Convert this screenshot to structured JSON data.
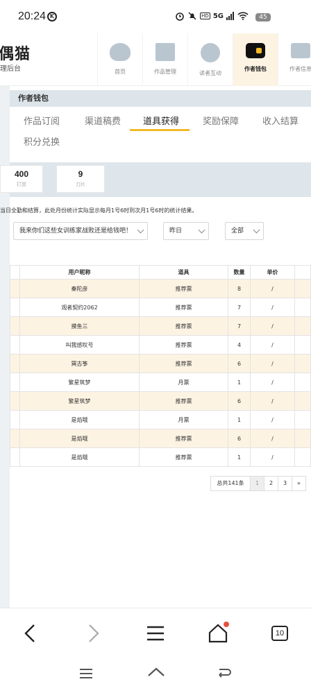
{
  "status_bar": {
    "time": "20:24",
    "network_label": "5G",
    "battery": "45"
  },
  "header": {
    "logo_title": "偶猫",
    "logo_subtitle": "理后台",
    "nav": [
      {
        "label": "首页",
        "icon": "cat-face-icon"
      },
      {
        "label": "作品管理",
        "icon": "book-icon"
      },
      {
        "label": "读者互动",
        "icon": "paw-bubble-icon"
      },
      {
        "label": "作者钱包",
        "icon": "wallet-icon",
        "active": true
      },
      {
        "label": "作者信息",
        "icon": "id-card-icon"
      }
    ]
  },
  "panel": {
    "title": "作者钱包",
    "tabs": [
      "作品订阅",
      "渠道稿费",
      "道具获得",
      "奖励保障",
      "收入结算",
      "积分兑换"
    ],
    "active_tab": "道具获得",
    "stats": [
      {
        "value": "400",
        "label": "打赏"
      },
      {
        "value": "9",
        "label": "刀片"
      }
    ],
    "note": "当日全勤和结算，此处月份统计实际显示每月1号6时到次月1号6时的统计结果。",
    "filters": {
      "book": "我来你们这些女训练家战败还是给钱吧！",
      "date": "昨日",
      "type": "全部"
    },
    "table": {
      "headers": [
        "用户昵称",
        "道具",
        "数量",
        "单价"
      ],
      "rows": [
        [
          "秦陀彦",
          "推荐票",
          "8",
          "/"
        ],
        [
          "观者契约2062",
          "推荐票",
          "7",
          "/"
        ],
        [
          "摸鱼三",
          "推荐票",
          "7",
          "/"
        ],
        [
          "叫我感叹号",
          "推荐票",
          "4",
          "/"
        ],
        [
          "巽古筝",
          "推荐票",
          "6",
          "/"
        ],
        [
          "繁星筑梦",
          "月票",
          "1",
          "/"
        ],
        [
          "繁星筑梦",
          "推荐票",
          "6",
          "/"
        ],
        [
          "是焰哦",
          "月票",
          "1",
          "/"
        ],
        [
          "是焰哦",
          "推荐票",
          "6",
          "/"
        ],
        [
          "是焰哦",
          "推荐票",
          "1",
          "/"
        ]
      ]
    },
    "pager": {
      "total": "总共141条",
      "pages": [
        "1",
        "2",
        "3"
      ],
      "next": "»"
    }
  },
  "browser": {
    "tab_count": "10"
  }
}
